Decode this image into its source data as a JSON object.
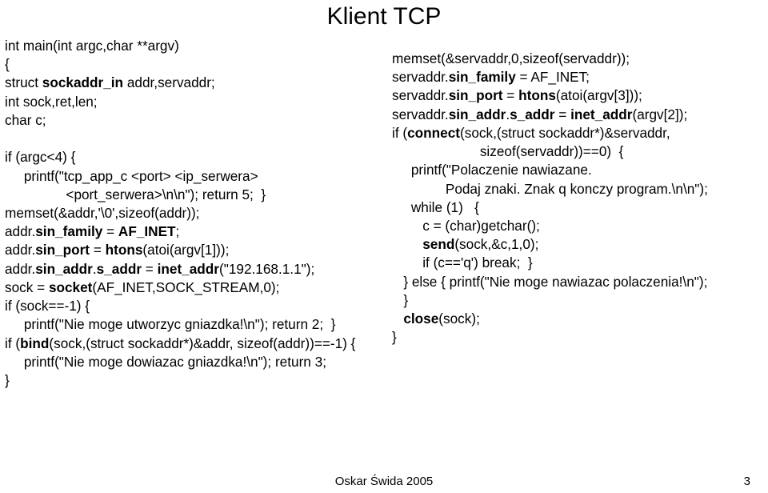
{
  "title": "Klient TCP",
  "left": {
    "l1": "int main(int argc,char **argv)",
    "l2": "{",
    "l3a": "struct ",
    "l3b": "sockaddr_in",
    "l3c": " addr,servaddr;",
    "l4": "int sock,ret,len;",
    "l5": "char c;",
    "l6": "if (argc<4) {",
    "l7": "     printf(\"tcp_app_c <port> <ip_serwera>",
    "l8": "                <port_serwera>\\n\\n\"); return 5;  }",
    "l9": "memset(&addr,'\\0',sizeof(addr));",
    "l10a": "addr.",
    "l10b": "sin_family",
    "l10c": " = ",
    "l10d": "AF_INET",
    "l10e": ";",
    "l11a": "addr.",
    "l11b": "sin_port",
    "l11c": " = ",
    "l11d": "htons",
    "l11e": "(atoi(argv[1]));",
    "l12a": "addr.",
    "l12b": "sin_addr",
    "l12c": ".",
    "l12d": "s_addr",
    "l12e": " = ",
    "l12f": "inet_addr",
    "l12g": "(\"192.168.1.1\");",
    "l13a": "sock = ",
    "l13b": "socket",
    "l13c": "(AF_INET,SOCK_STREAM,0);",
    "l14": "if (sock==-1) {",
    "l15": "     printf(\"Nie moge utworzyc gniazdka!\\n\"); return 2;  }",
    "l16a": "if (",
    "l16b": "bind",
    "l16c": "(sock,(struct sockaddr*)&addr, sizeof(addr))==-1) {",
    "l17": "     printf(\"Nie moge dowiazac gniazdka!\\n\"); return 3;",
    "l18": "}"
  },
  "right": {
    "l1": "memset(&servaddr,0,sizeof(servaddr));",
    "l2a": "servaddr.",
    "l2b": "sin_family",
    "l2c": " = AF_INET;",
    "l3a": "servaddr.",
    "l3b": "sin_port",
    "l3c": " = ",
    "l3d": "htons",
    "l3e": "(atoi(argv[3]));",
    "l4a": "servaddr.",
    "l4b": "sin_addr",
    "l4c": ".",
    "l4d": "s_addr",
    "l4e": " = ",
    "l4f": "inet_addr",
    "l4g": "(argv[2]);",
    "l5a": "if (",
    "l5b": "connect",
    "l5c": "(sock,(struct sockaddr*)&servaddr,",
    "l6": "                       sizeof(servaddr))==0)  {",
    "l7": "     printf(\"Polaczenie nawiazane.",
    "l8": "              Podaj znaki. Znak q konczy program.\\n\\n\");",
    "l9": "     while (1)   {",
    "l10": "        c = (char)getchar();",
    "l11a": "        ",
    "l11b": "send",
    "l11c": "(sock,&c,1,0);",
    "l12": "        if (c=='q') break;  }",
    "l13": "   } else { printf(\"Nie moge nawiazac polaczenia!\\n\");",
    "l14": "   }",
    "l15a": "   ",
    "l15b": "close",
    "l15c": "(sock);",
    "l16": "}"
  },
  "footer": "Oskar Świda 2005",
  "pagenum": "3"
}
